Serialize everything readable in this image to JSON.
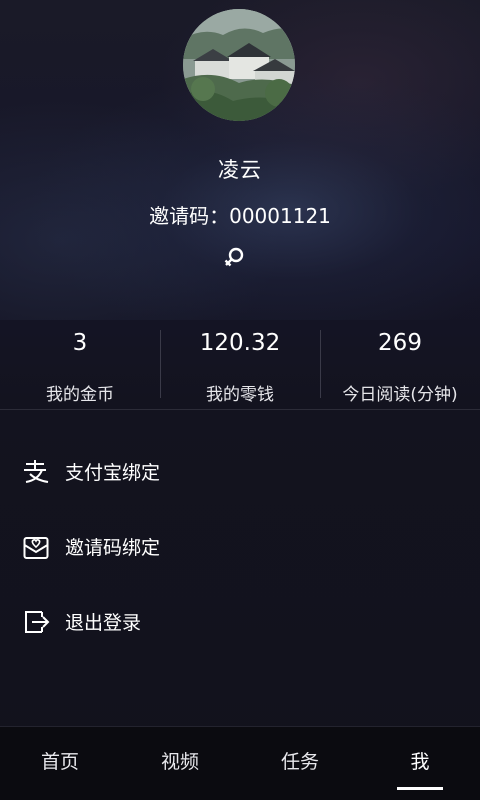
{
  "profile": {
    "nickname": "凌云",
    "invite_text": "邀请码：00001121",
    "gender_icon": "female-symbol"
  },
  "stats": [
    {
      "value": "3",
      "label": "我的金币"
    },
    {
      "value": "120.32",
      "label": "我的零钱"
    },
    {
      "value": "269",
      "label": "今日阅读(分钟)"
    }
  ],
  "menu": [
    {
      "label": "支付宝绑定",
      "icon": "alipay-icon"
    },
    {
      "label": "邀请码绑定",
      "icon": "invite-envelope-icon"
    },
    {
      "label": "退出登录",
      "icon": "logout-icon"
    }
  ],
  "tabs": [
    {
      "label": "首页",
      "active": false
    },
    {
      "label": "视频",
      "active": false
    },
    {
      "label": "任务",
      "active": false
    },
    {
      "label": "我",
      "active": true
    }
  ],
  "colors": {
    "background": "#13131e",
    "text": "#ffffff",
    "tabbar": "#0b0b10"
  }
}
